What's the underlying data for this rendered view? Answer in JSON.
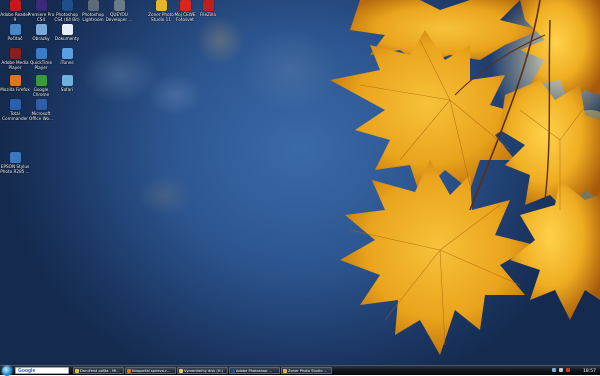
{
  "desktop_icons": [
    {
      "label": "Adobe Reader 9",
      "icon": "adobe-reader-icon",
      "color": "#c8161d"
    },
    {
      "label": "Premiere Pro CS4",
      "icon": "premiere-icon",
      "color": "#3a2a7a"
    },
    {
      "label": "Photoshop CS4 (64 Bit)",
      "icon": "photoshop-icon",
      "color": "#1c4f8c"
    },
    {
      "label": "Photoshop Lightroom",
      "icon": "lightroom-icon",
      "color": "#5b6b7a"
    },
    {
      "label": "QUEYOU Developer ...",
      "icon": "developer-icon",
      "color": "#6b7a8a"
    },
    {
      "label": "Zoner Photo Studio 11",
      "icon": "zoner-icon",
      "color": "#e7b52a"
    },
    {
      "label": "Moj ČEWE Fotosvet",
      "icon": "cewe-icon",
      "color": "#d9251c"
    },
    {
      "label": "FileZilla",
      "icon": "filezilla-icon",
      "color": "#bf1e1e"
    },
    {
      "label": "Počítač",
      "icon": "computer-icon",
      "color": "#4a86c5"
    },
    {
      "label": "Obrázky",
      "icon": "pictures-icon",
      "color": "#7aa8d8"
    },
    {
      "label": "Dokumenty",
      "icon": "documents-icon",
      "color": "#e8eef5"
    },
    {
      "label": "Adobe Media Player",
      "icon": "media-player-icon",
      "color": "#8a1e1e"
    },
    {
      "label": "QuickTime Player",
      "icon": "quicktime-icon",
      "color": "#3a7cc8"
    },
    {
      "label": "iTunes",
      "icon": "itunes-icon",
      "color": "#5aa0e0"
    },
    {
      "label": "Mozilla Firefox",
      "icon": "firefox-icon",
      "color": "#e0761c"
    },
    {
      "label": "Google Chrome",
      "icon": "chrome-icon",
      "color": "#3b9b3b"
    },
    {
      "label": "Safari",
      "icon": "safari-icon",
      "color": "#6fb0e0"
    },
    {
      "label": "Total Commander",
      "icon": "total-commander-icon",
      "color": "#2a5fb0"
    },
    {
      "label": "Microsoft Office Wo...",
      "icon": "word-icon",
      "color": "#2f5da8"
    },
    {
      "label": "EPSON Stylus Photo R285 ...",
      "icon": "printer-icon",
      "color": "#3c78c0"
    }
  ],
  "taskbar": {
    "search_label": "Google",
    "items": [
      {
        "label": "Doručená pošta - Mi...",
        "icon": "mail-icon",
        "color": "#e0c040"
      },
      {
        "label": "fotoportál sprievo.c...",
        "icon": "browser-icon",
        "color": "#e0761c"
      },
      {
        "label": "Vymeniteľný disk (H:)",
        "icon": "folder-icon",
        "color": "#e8c860"
      },
      {
        "label": "Adobe Photoshop ...",
        "icon": "photoshop-icon",
        "color": "#1c4f8c"
      },
      {
        "label": "Zoner Photo Studio ...",
        "icon": "zoner-icon",
        "color": "#e7b52a"
      }
    ],
    "clock": "18:57"
  }
}
